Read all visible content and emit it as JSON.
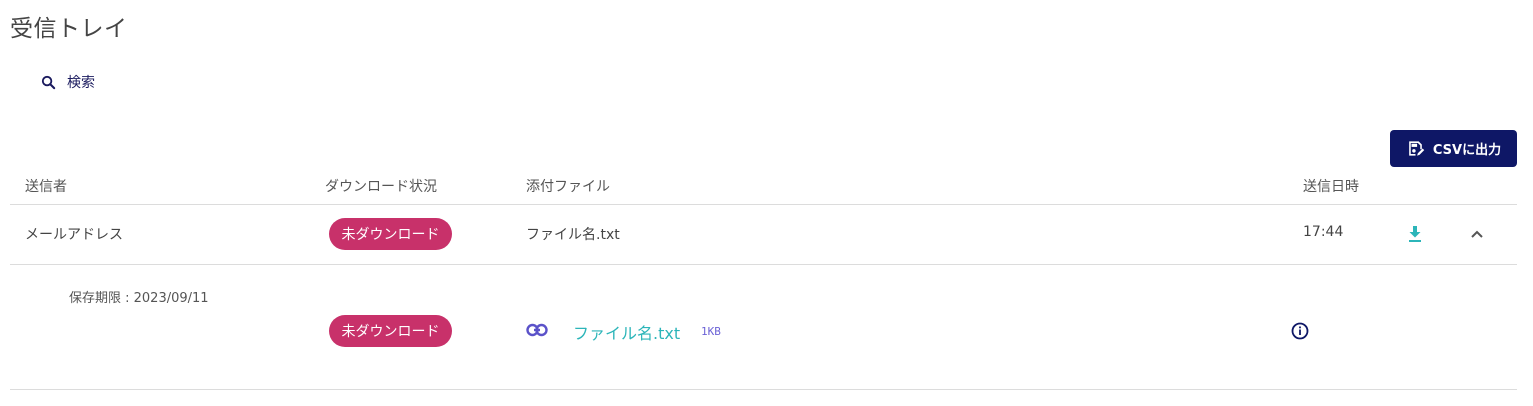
{
  "page": {
    "title": "受信トレイ"
  },
  "search": {
    "label": "検索"
  },
  "toolbar": {
    "csv_label": "CSVに出力"
  },
  "table": {
    "headers": {
      "sender": "送信者",
      "download_status": "ダウンロード状況",
      "attachment": "添付ファイル",
      "sent_at": "送信日時"
    },
    "row": {
      "sender": "メールアドレス",
      "status": "未ダウンロード",
      "file_name": "ファイル名.txt",
      "time": "17:44"
    },
    "detail": {
      "retention": "保存期限 : 2023/09/11",
      "status": "未ダウンロード",
      "file_name": "ファイル名.txt",
      "file_size": "1KB"
    }
  },
  "colors": {
    "primary": "#0e1766",
    "badge": "#c8316a",
    "link": "#2cb5b9",
    "size": "#6c63d6",
    "link_icon": "#5b52c9"
  },
  "icons": [
    "search-icon",
    "csv-export-icon",
    "download-icon",
    "chevron-up-icon",
    "link-icon",
    "info-icon"
  ]
}
